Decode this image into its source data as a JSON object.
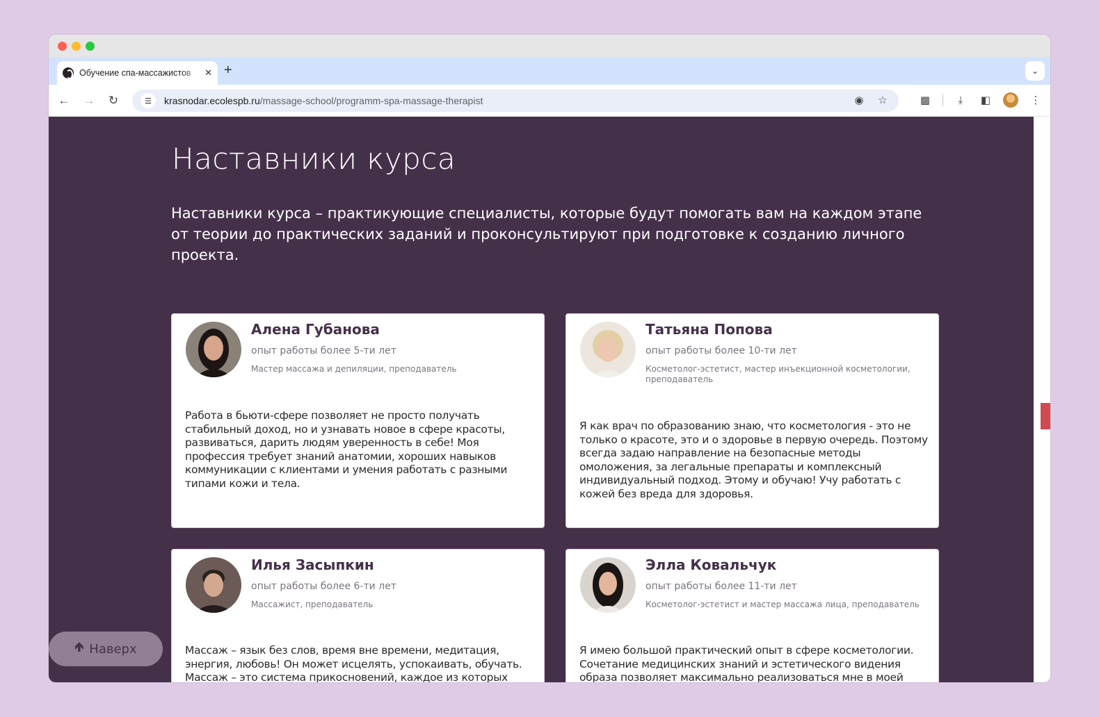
{
  "browser": {
    "tab_title": "Обучение спа-массажистов",
    "tab_close": "✕",
    "new_tab": "+",
    "url_host": "krasnodar.ecolespb.ru",
    "url_path": "/massage-school/programm-spa-massage-therapist"
  },
  "section": {
    "title": "Наставники курса",
    "description": "Наставники курса – практикующие специалисты, которые будут помогать вам на каждом этапе от теории до практических заданий и проконсультируют при подготовке к созданию личного проекта."
  },
  "mentors": [
    {
      "name": "Алена Губанова",
      "experience": "опыт работы более 5-ти лет",
      "role": "Мастер массажа и депиляции, преподаватель",
      "quote": "Работа в бьюти-сфере позволяет не просто получать стабильный доход, но и узнавать новое в сфере красоты, развиваться, дарить людям уверенность в себе! Моя профессия требует знаний анатомии, хороших навыков коммуникации с клиентами и умения работать с разными типами кожи и тела."
    },
    {
      "name": "Татьяна Попова",
      "experience": "опыт работы более 10-ти лет",
      "role": "Косметолог-эстетист, мастер инъекционной косметологии, преподаватель",
      "quote": "Я как врач по образованию знаю, что косметология - это не только о красоте, это и о здоровье в первую очередь. Поэтому всегда задаю направление на безопасные методы омоложения, за легальные препараты и комплексный индивидуальный подход. Этому и обучаю! Учу работать с кожей без вреда для здоровья."
    },
    {
      "name": "Илья Засыпкин",
      "experience": "опыт работы более 6-ти лет",
      "role": "Массажист, преподаватель",
      "quote": "Массаж – язык без слов, время вне времени, медитация, энергия, любовь! Он может исцелять, успокаивать, обучать. Массаж – это система прикосновений, каждое из которых питает тело, ум, душу"
    },
    {
      "name": "Элла Ковальчук",
      "experience": "опыт работы более 11-ти лет",
      "role": "Косметолог-эстетист и мастер массажа лица, преподаватель",
      "quote": "Я имею большой практический опыт в сфере косметологии. Сочетание медицинских знаний и эстетического видения образа позволяет максимально реализоваться мне в моей работе. Я"
    }
  ],
  "back_to_top": "Наверх",
  "colors": {
    "page_bg": "#45304a",
    "card_bg": "#ffffff",
    "accent": "#d14a52",
    "outer_bg": "#dfcbe5"
  }
}
